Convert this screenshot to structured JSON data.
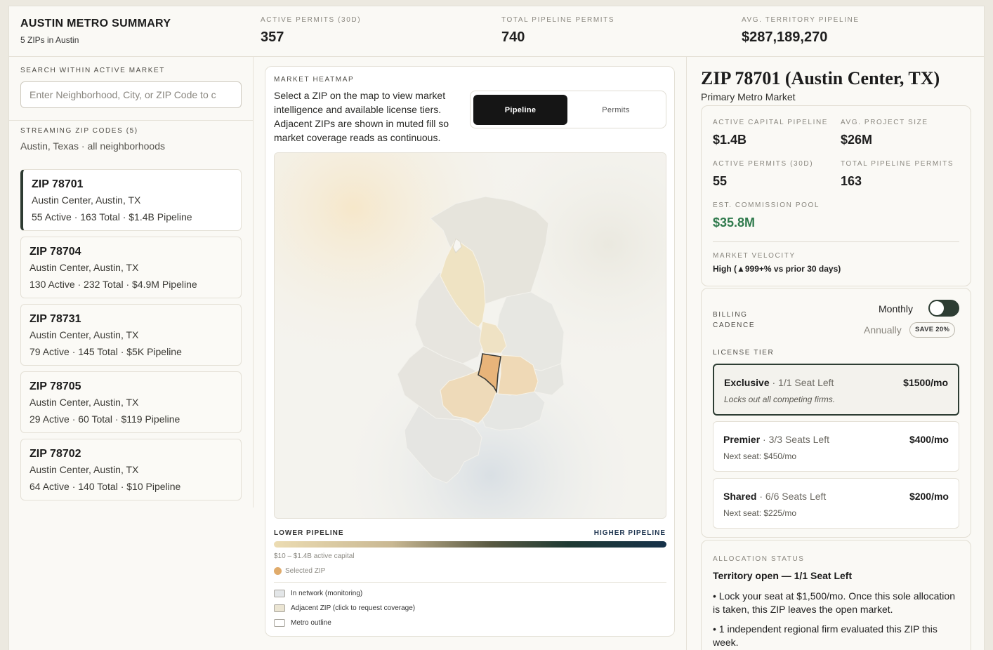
{
  "header": {
    "title": "AUSTIN METRO SUMMARY",
    "subtitle": "5 ZIPs in Austin",
    "stats": [
      {
        "label": "ACTIVE PERMITS (30D)",
        "value": "357"
      },
      {
        "label": "TOTAL PIPELINE PERMITS",
        "value": "740"
      },
      {
        "label": "AVG. TERRITORY PIPELINE",
        "value": "$287,189,270"
      }
    ]
  },
  "left": {
    "search_label": "SEARCH WITHIN ACTIVE MARKET",
    "search_placeholder": "Enter Neighborhood, City, or ZIP Code to c",
    "search_value": "",
    "streaming_label": "STREAMING ZIP CODES (5)",
    "streaming_sub": "Austin, Texas · all neighborhoods",
    "zips": [
      {
        "title": "ZIP 78701",
        "location": "Austin Center, Austin, TX",
        "stats": "55 Active · 163 Total · $1.4B Pipeline",
        "selected": true
      },
      {
        "title": "ZIP 78704",
        "location": "Austin Center, Austin, TX",
        "stats": "130 Active · 232 Total · $4.9M Pipeline",
        "selected": false
      },
      {
        "title": "ZIP 78731",
        "location": "Austin Center, Austin, TX",
        "stats": "79 Active · 145 Total · $5K Pipeline",
        "selected": false
      },
      {
        "title": "ZIP 78705",
        "location": "Austin Center, Austin, TX",
        "stats": "29 Active · 60 Total · $119 Pipeline",
        "selected": false
      },
      {
        "title": "ZIP 78702",
        "location": "Austin Center, Austin, TX",
        "stats": "64 Active · 140 Total · $10 Pipeline",
        "selected": false
      }
    ]
  },
  "map": {
    "label": "MARKET HEATMAP",
    "description": "Select a ZIP on the map to view market intelligence and available license tiers. Adjacent ZIPs are shown in muted fill so market coverage reads as continuous.",
    "tabs": [
      {
        "label": "Pipeline",
        "active": true
      },
      {
        "label": "Permits",
        "active": false
      }
    ],
    "legend_low": "LOWER PIPELINE",
    "legend_high": "HIGHER PIPELINE",
    "range": "$10 – $1.4B active capital",
    "selected_label": "Selected ZIP",
    "keys": [
      {
        "label": "In network (monitoring)",
        "color": "#e3e6e8"
      },
      {
        "label": "Adjacent ZIP (click to request coverage)",
        "color": "#ebe5d3"
      },
      {
        "label": "Metro outline",
        "color": "#ffffff"
      }
    ],
    "colors": {
      "selected": "#e8b47a",
      "accent_dark": "#2d3d33"
    }
  },
  "detail": {
    "title": "ZIP 78701 (Austin Center, TX)",
    "subtitle": "Primary Metro Market",
    "metrics": [
      {
        "label": "ACTIVE CAPITAL PIPELINE",
        "value": "$1.4B"
      },
      {
        "label": "AVG. PROJECT SIZE",
        "value": "$26M"
      },
      {
        "label": "ACTIVE PERMITS (30D)",
        "value": "55"
      },
      {
        "label": "TOTAL PIPELINE PERMITS",
        "value": "163"
      },
      {
        "label": "EST. COMMISSION POOL",
        "value": "$35.8M"
      }
    ],
    "velocity_label": "MARKET VELOCITY",
    "velocity_value": "High (▲999+% vs prior 30 days)",
    "billing": {
      "label": "BILLING CADENCE",
      "monthly": "Monthly",
      "annually": "Annually",
      "save_badge": "SAVE 20%"
    },
    "license_label": "LICENSE TIER",
    "tiers": [
      {
        "name": "Exclusive",
        "seats": " · 1/1 Seat Left",
        "price": "$1500/mo",
        "note": "Locks out all competing firms.",
        "selected": true
      },
      {
        "name": "Premier",
        "seats": " · 3/3 Seats Left",
        "price": "$400/mo",
        "note": "Next seat: $450/mo",
        "selected": false
      },
      {
        "name": "Shared",
        "seats": " · 6/6 Seats Left",
        "price": "$200/mo",
        "note": "Next seat: $225/mo",
        "selected": false
      }
    ],
    "allocation": {
      "label": "ALLOCATION STATUS",
      "title": "Territory open — 1/1 Seat Left",
      "bullets": [
        "• Lock your seat at $1,500/mo. Once this sole allocation is taken, this ZIP leaves the open market.",
        "• 1 independent regional firm evaluated this ZIP this week."
      ]
    }
  }
}
